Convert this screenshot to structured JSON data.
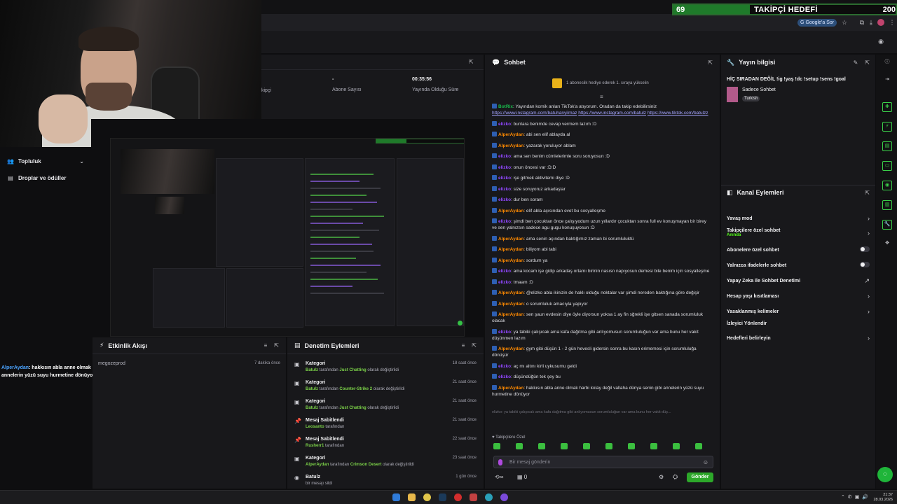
{
  "goal": {
    "current": "69",
    "title": "TAKİPÇİ HEDEFİ",
    "target": "200",
    "progress_fraction": 0.345
  },
  "browser": {
    "google_button": "Google'a Sor"
  },
  "sidebar": {
    "items": [
      {
        "label": "Topluluk",
        "icon": "users-icon"
      },
      {
        "label": "Droplar ve ödüller",
        "icon": "gift-icon"
      }
    ]
  },
  "stats": {
    "follower_label": "kipçi",
    "sub_value": "-",
    "sub_label": "Abone Sayısı",
    "uptime_value": "00:35:56",
    "uptime_label": "Yayında Olduğu Süre"
  },
  "activity": {
    "title": "Etkinlik Akışı",
    "entry_user": "megozeprod",
    "entry_time": "7 dakika önce"
  },
  "overlay_chat": {
    "user": "AlperAydan",
    "text": ": hakkısın abla anne olmak harbi kolay değil vallaha dünya senin gibi annelerin yüzü suyu hurmetine dönüyor"
  },
  "moderation": {
    "title": "Denetim Eylemleri",
    "rows": [
      {
        "icon": "category-icon",
        "title": "Kategori",
        "user": "Batulz",
        "mid": " tarafından ",
        "target": "Just Chatting",
        "tail": " olarak değiştirildi",
        "time": "18 saat önce"
      },
      {
        "icon": "category-icon",
        "title": "Kategori",
        "user": "Batulz",
        "mid": " tarafından ",
        "target": "Counter-Strike 2",
        "tail": " olarak değiştirildi",
        "time": "21 saat önce"
      },
      {
        "icon": "category-icon",
        "title": "Kategori",
        "user": "Batulz",
        "mid": " tarafından ",
        "target": "Just Chatting",
        "tail": " olarak değiştirildi",
        "time": "21 saat önce"
      },
      {
        "icon": "pin-icon",
        "title": "Mesaj Sabitlendi",
        "user": "Leosanto",
        "mid": " tarafından",
        "target": "",
        "tail": "",
        "time": "21 saat önce"
      },
      {
        "icon": "pin-icon",
        "title": "Mesaj Sabitlendi",
        "user": "Rusherr1",
        "mid": " tarafından",
        "target": "",
        "tail": "",
        "time": "22 saat önce"
      },
      {
        "icon": "category-icon",
        "title": "Kategori",
        "user": "AlperAydan",
        "mid": " tarafından ",
        "target": "Crimson Desert",
        "tail": " olarak değiştirildi",
        "time": "23 saat önce"
      },
      {
        "icon": "user-icon",
        "title": "Batulz",
        "user": "",
        "mid": "bir mesajı sildi",
        "target": "",
        "tail": "",
        "time": "1 gün önce"
      }
    ]
  },
  "chat": {
    "title": "Sohbet",
    "promo": "1 aboneslik hediye ederek 1. sıraya yükselin",
    "messages": [
      {
        "user": "BotRix",
        "cls": "u-bot",
        "text": ": Yayından komik anları TikTok'a atıyorum. Oradan da takip edebilirsiniz ",
        "links": [
          "https://www.instagram.com/batuhanyilmaz",
          "https://www.instagram.com/batulz",
          "https://www.tiktok.com/batulzz"
        ]
      },
      {
        "user": "elizko",
        "cls": "u-elizko",
        "text": ": bunlara benimde cevap vermem lazım :D"
      },
      {
        "user": "AlperAydan",
        "cls": "u-alper",
        "text": ": abi sen elif ablayda al"
      },
      {
        "user": "AlperAydan",
        "cls": "u-alper",
        "text": ": yazarak yoruluyor ablam"
      },
      {
        "user": "elizko",
        "cls": "u-elizko",
        "text": ": ama sen benim cümlelerimle soru soruyosun :D"
      },
      {
        "user": "elizko",
        "cls": "u-elizko",
        "text": ": onun öncesi var :D:D"
      },
      {
        "user": "elizko",
        "cls": "u-elizko",
        "text": ": işe gitmek aktivitemi diye :D"
      },
      {
        "user": "elizko",
        "cls": "u-elizko",
        "text": ": size soruyoruz arkadaşlar"
      },
      {
        "user": "elizko",
        "cls": "u-elizko",
        "text": ": dur ben soram"
      },
      {
        "user": "AlperAydan",
        "cls": "u-alper",
        "text": ": elif abla açısından evet bu sosyalleşme"
      },
      {
        "user": "elizko",
        "cls": "u-elizko",
        "text": ": şimdi ben çocuktan önce çalışıyodum uzun yıllardır çocuktan sonra full ev konuşmayan bir birey ve sen yalnızsın sadece agu gugu konuşuyosun :D"
      },
      {
        "user": "AlperAydan",
        "cls": "u-alper",
        "text": ": ama senin açından baktığımız zaman bi sorumluluktü"
      },
      {
        "user": "AlperAydan",
        "cls": "u-alper",
        "text": ": biliyom abi tabi"
      },
      {
        "user": "AlperAydan",
        "cls": "u-alper",
        "text": ": sordum ya"
      },
      {
        "user": "elizko",
        "cls": "u-elizko",
        "text": ": ama kocam işe gidip arkadaş ortamı birinin nasısn napıyosun demesi bile benim için sosyalleşme"
      },
      {
        "user": "elizko",
        "cls": "u-elizko",
        "text": ": tmaam :D"
      },
      {
        "user": "AlperAydan",
        "cls": "u-alper",
        "text": ": @elizko abla ikinizin de haklı olduğu noktalar var şimdi nereden baktığına göre değişir"
      },
      {
        "user": "AlperAydan",
        "cls": "u-alper",
        "text": ": o sorumluluk amacıyla yapıyor"
      },
      {
        "user": "AlperAydan",
        "cls": "u-alper",
        "text": ": sen şaun evdesin diye öyle diyorsun yoksa 1 ay fin sğrekli işe gitsen sanada sorumluluk olacak"
      },
      {
        "user": "elizko",
        "cls": "u-elizko",
        "text": ": ya tabiki çalışıcak ama kafa dağıtma gibi anlıyomusun sorumluluğun var ama bunu her vakit düşünmen lazım"
      },
      {
        "user": "AlperAydan",
        "cls": "u-alper",
        "text": ": gym gibi düşün 1 - 2 gün hevesli gidersin sonra bu kasın erimemesi için sorumluluğa dönüşür"
      },
      {
        "user": "elizko",
        "cls": "u-elizko",
        "text": ": aç mı altını kirli uykusumu geldi"
      },
      {
        "user": "elizko",
        "cls": "u-elizko",
        "text": ": düşündüğün tek şey bu"
      },
      {
        "user": "AlperAydan",
        "cls": "u-alper",
        "text": ": hakkısın abla anne olmak harbi kolay değil vallaha dünya senin gibi annelerin yüzü suyu hurmetine dönüyor"
      }
    ],
    "faded_line": "elizko: ya tabiki çalışıcak ama kafa dağıtma gibi anlıyomusun sorumluluğun var ama bunu her vakit düş...",
    "followers_only": "Takipçilere Özel",
    "input_placeholder": "Bir mesaj gönderin",
    "points": "0",
    "send_label": "Gönder"
  },
  "stream_info": {
    "title": "Yayın bilgisi",
    "stream_title": "HİÇ SIRADAN DEĞİL !ig !yaş !dc !setup !sens !goal",
    "category": "Sadece Sohbet",
    "tag": "Turkish"
  },
  "channel_actions": {
    "title": "Kanal Eylemleri",
    "items": [
      {
        "label": "Yavaş mod",
        "control": "chevron"
      },
      {
        "label": "Takipçilere özel sohbet",
        "sub": "Anında",
        "control": "chevron"
      },
      {
        "label": "Abonelere özel sohbet",
        "control": "toggle"
      },
      {
        "label": "Yalnızca ifadelerle sohbet",
        "control": "toggle"
      },
      {
        "label": "Yapay Zeka ile Sohbet Denetimi",
        "control": "external"
      },
      {
        "label": "Hesap yaşı kısıtlaması",
        "control": "chevron"
      },
      {
        "label": "Yasaklanmış kelimeler",
        "control": "chevron"
      },
      {
        "label": "İzleyici Yönlendir",
        "control": "none"
      },
      {
        "label": "Hedefleri belirleyin",
        "control": "chevron"
      }
    ]
  },
  "taskbar": {
    "time": "21:37",
    "date": "28.03.2026"
  },
  "colors": {
    "accent": "#53fc18",
    "chat_alper": "#ff8a00",
    "chat_elizko": "#9147ff",
    "send": "#2da82a"
  }
}
